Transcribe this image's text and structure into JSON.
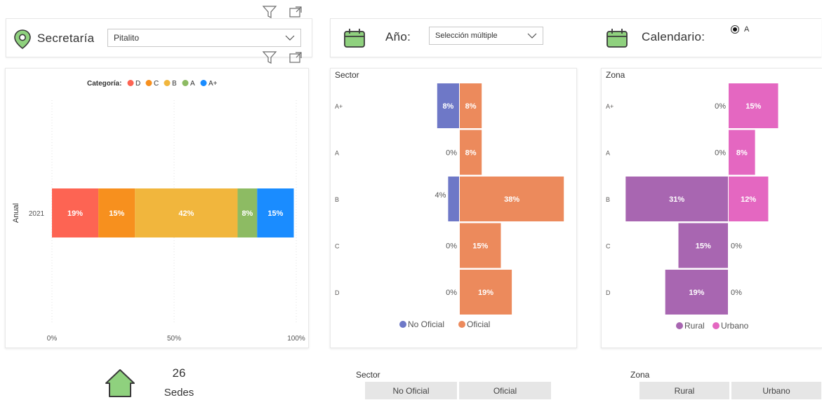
{
  "secretaria": {
    "label": "Secretaría",
    "value": "Pitalito"
  },
  "anio": {
    "label": "Año:",
    "value": "Selección múltiple"
  },
  "calendario": {
    "label": "Calendario:",
    "option": "A"
  },
  "kpi": {
    "value": "26",
    "label": "Sedes"
  },
  "sector_slicer": {
    "title": "Sector",
    "options": [
      "No Oficial",
      "Oficial"
    ]
  },
  "zona_slicer": {
    "title": "Zona",
    "options": [
      "Rural",
      "Urbano"
    ]
  },
  "colors": {
    "D": "#fd6453",
    "C": "#f7901e",
    "B": "#f1b63d",
    "A": "#8dbb63",
    "A+": "#1a8cff",
    "no_oficial": "#6e78c7",
    "oficial": "#ec8a5c",
    "rural": "#a866b1",
    "urbano": "#e467c1",
    "icon_green": "#8fd17e"
  },
  "chart_data": [
    {
      "type": "bar",
      "orientation": "horizontal-stacked-100",
      "legend_title": "Categoría:",
      "legend_position": "top-center",
      "ylabel": "Anual",
      "categories": [
        "2021"
      ],
      "x_ticks": [
        "0%",
        "50%",
        "100%"
      ],
      "xlim": [
        0,
        100
      ],
      "series": [
        {
          "name": "D",
          "values": [
            19
          ],
          "label": "19%"
        },
        {
          "name": "C",
          "values": [
            15
          ],
          "label": "15%"
        },
        {
          "name": "B",
          "values": [
            42
          ],
          "label": "42%"
        },
        {
          "name": "A",
          "values": [
            8
          ],
          "label": "8%"
        },
        {
          "name": "A+",
          "values": [
            15
          ],
          "label": "15%"
        }
      ]
    },
    {
      "type": "bar",
      "orientation": "butterfly",
      "title": "Sector",
      "legend_position": "bottom-center",
      "categories": [
        "A+",
        "A",
        "B",
        "C",
        "D"
      ],
      "series": [
        {
          "name": "No Oficial",
          "side": "left",
          "values": [
            8,
            0,
            4,
            0,
            0
          ],
          "labels": [
            "8%",
            "0%",
            "4%",
            "0%",
            "0%"
          ]
        },
        {
          "name": "Oficial",
          "side": "right",
          "values": [
            8,
            8,
            38,
            15,
            19
          ],
          "labels": [
            "8%",
            "8%",
            "38%",
            "15%",
            "19%"
          ]
        }
      ]
    },
    {
      "type": "bar",
      "orientation": "butterfly",
      "title": "Zona",
      "legend_position": "bottom-center",
      "categories": [
        "A+",
        "A",
        "B",
        "C",
        "D"
      ],
      "series": [
        {
          "name": "Rural",
          "side": "left",
          "values": [
            0,
            0,
            31,
            15,
            19
          ],
          "labels": [
            "0%",
            "0%",
            "31%",
            "15%",
            "19%"
          ]
        },
        {
          "name": "Urbano",
          "side": "right",
          "values": [
            15,
            8,
            12,
            0,
            0
          ],
          "labels": [
            "15%",
            "8%",
            "12%",
            "0%",
            "0%"
          ]
        }
      ]
    }
  ]
}
